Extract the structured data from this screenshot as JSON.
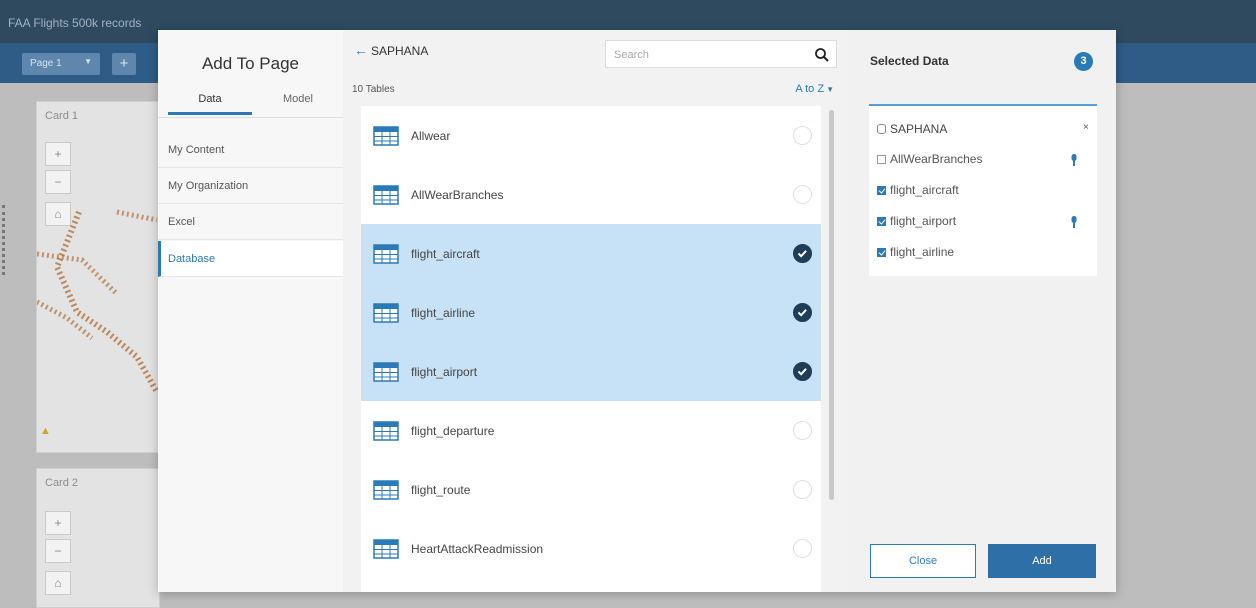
{
  "app": {
    "title": "FAA Flights 500k records",
    "page_tab": "Page 1",
    "add_page": "+",
    "card1_title": "Card 1",
    "card2_title": "Card 2",
    "zoom_in": "+",
    "zoom_out": "−",
    "home": "⌂"
  },
  "modal": {
    "title": "Add To Page",
    "tabs": {
      "data": "Data",
      "model": "Model"
    },
    "nav": [
      {
        "label": "My Content",
        "active": false
      },
      {
        "label": "My Organization",
        "active": false
      },
      {
        "label": "Excel",
        "active": false
      },
      {
        "label": "Database",
        "active": true
      }
    ]
  },
  "list": {
    "back_label": "SAPHANA",
    "search_placeholder": "Search",
    "count": "10 Tables",
    "sort": "A to Z",
    "rows": [
      {
        "label": "Allwear",
        "selected": false
      },
      {
        "label": "AllWearBranches",
        "selected": false
      },
      {
        "label": "flight_aircraft",
        "selected": true
      },
      {
        "label": "flight_airline",
        "selected": true
      },
      {
        "label": "flight_airport",
        "selected": true
      },
      {
        "label": "flight_departure",
        "selected": false
      },
      {
        "label": "flight_route",
        "selected": false
      },
      {
        "label": "HeartAttackReadmission",
        "selected": false
      }
    ]
  },
  "selected": {
    "title": "Selected Data",
    "count": "3",
    "db": "SAPHANA",
    "remove": "×",
    "items": [
      {
        "label": "AllWearBranches",
        "checked": false,
        "key": true
      },
      {
        "label": "flight_aircraft",
        "checked": true,
        "key": false
      },
      {
        "label": "flight_airport",
        "checked": true,
        "key": true
      },
      {
        "label": "flight_airline",
        "checked": true,
        "key": false
      }
    ],
    "close_label": "Close",
    "add_label": "Add"
  },
  "colors": {
    "accent": "#2a7ab8",
    "selected_row": "#c7e2f6",
    "check_dark": "#1f3d58",
    "header_bg": "#2f4a5f"
  }
}
